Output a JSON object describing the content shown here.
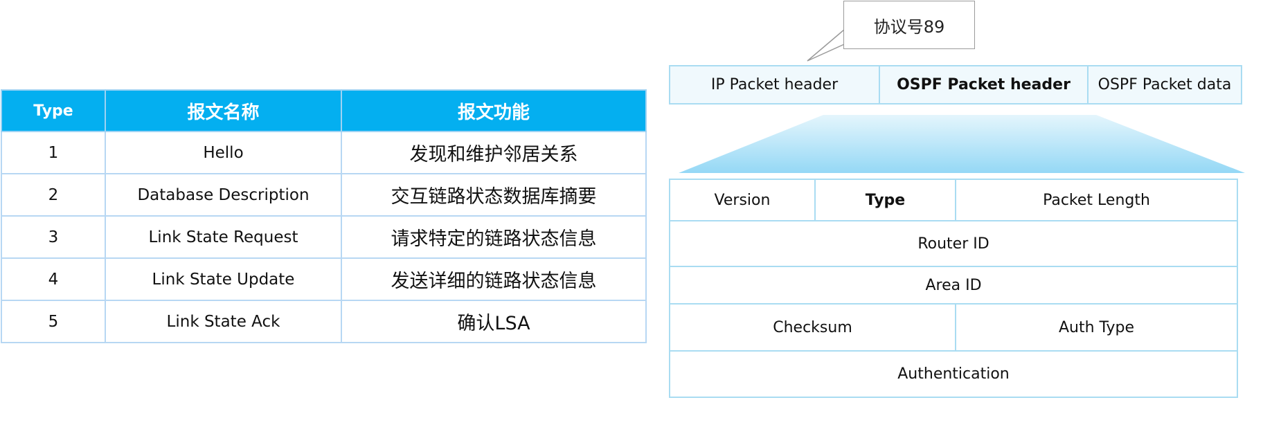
{
  "table": {
    "headers": [
      "Type",
      "报文名称",
      "报文功能"
    ],
    "rows": [
      {
        "type": "1",
        "name": "Hello",
        "function": "发现和维护邻居关系"
      },
      {
        "type": "2",
        "name": "Database Description",
        "function": "交互链路状态数据库摘要"
      },
      {
        "type": "3",
        "name": "Link State Request",
        "function": "请求特定的链路状态信息"
      },
      {
        "type": "4",
        "name": "Link State Update",
        "function": "发送详细的链路状态信息"
      },
      {
        "type": "5",
        "name": "Link State Ack",
        "function": "确认LSA"
      }
    ]
  },
  "callout": {
    "text": "协议号89"
  },
  "packet": {
    "segments": [
      {
        "label": "IP Packet header",
        "bold": false
      },
      {
        "label": "OSPF Packet header",
        "bold": true
      },
      {
        "label": "OSPF Packet data",
        "bold": false
      }
    ]
  },
  "ospf_header": {
    "version": "Version",
    "type": "Type",
    "packet_length": "Packet Length",
    "router_id": "Router ID",
    "area_id": "Area ID",
    "checksum": "Checksum",
    "auth_type": "Auth Type",
    "authentication": "Authentication"
  },
  "colors": {
    "table_header_bg": "#04aff0",
    "border_light_blue": "#a9dcf2",
    "packet_bar_bg": "#f0f9fd",
    "trapezoid_top": "#d8f1fb",
    "trapezoid_bottom": "#8fd6f5"
  }
}
